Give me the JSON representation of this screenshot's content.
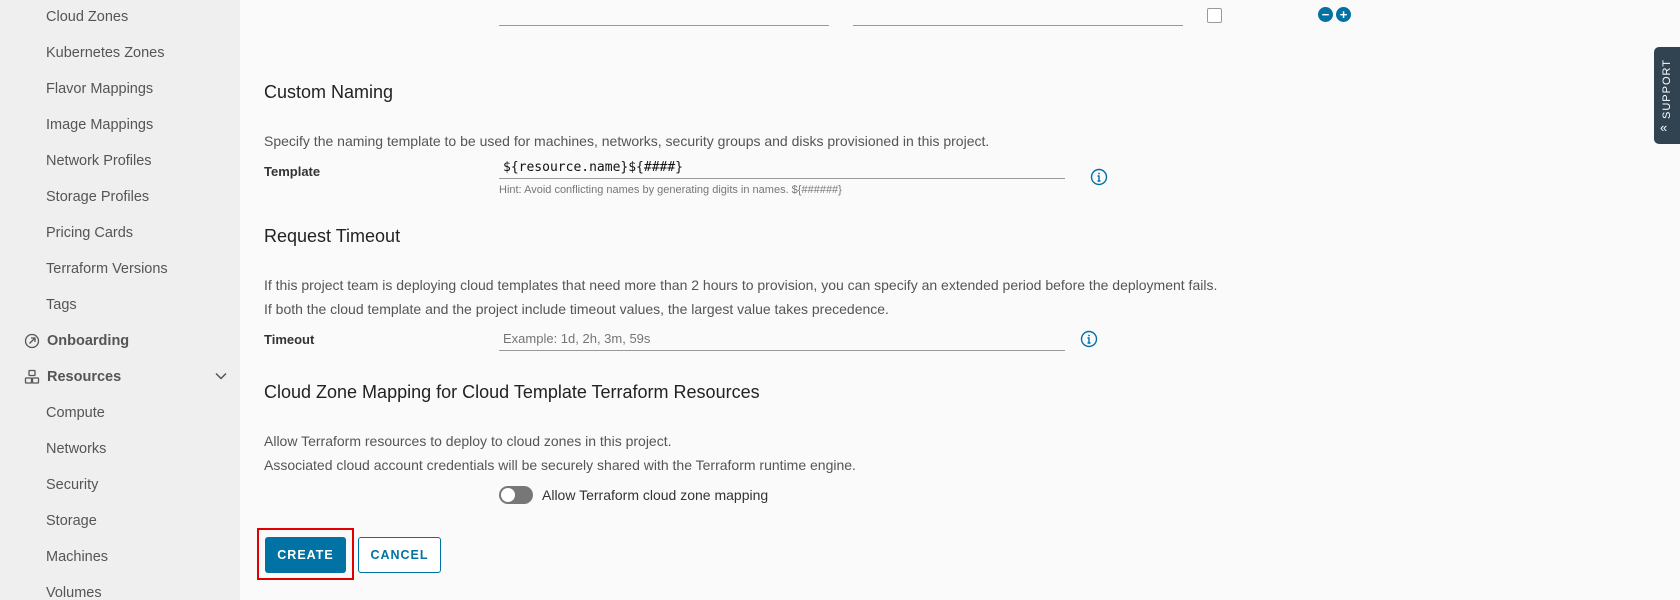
{
  "sidebar": {
    "items": [
      {
        "label": "Cloud Zones"
      },
      {
        "label": "Kubernetes Zones"
      },
      {
        "label": "Flavor Mappings"
      },
      {
        "label": "Image Mappings"
      },
      {
        "label": "Network Profiles"
      },
      {
        "label": "Storage Profiles"
      },
      {
        "label": "Pricing Cards"
      },
      {
        "label": "Terraform Versions"
      },
      {
        "label": "Tags"
      }
    ],
    "onboarding": {
      "label": "Onboarding",
      "icon": "onboarding-icon"
    },
    "resources": {
      "label": "Resources",
      "icon": "resources-icon",
      "expanded": true,
      "items": [
        {
          "label": "Compute"
        },
        {
          "label": "Networks"
        },
        {
          "label": "Security"
        },
        {
          "label": "Storage"
        },
        {
          "label": "Machines"
        },
        {
          "label": "Volumes"
        }
      ]
    }
  },
  "top_row": {
    "input1_value": "",
    "input2_value": "",
    "checkbox_checked": false,
    "remove_symbol": "−",
    "add_symbol": "+"
  },
  "custom_naming": {
    "title": "Custom Naming",
    "description": "Specify the naming template to be used for machines, networks, security groups and disks provisioned in this project.",
    "template_label": "Template",
    "template_value": "${resource.name}${####}",
    "hint": "Hint: Avoid conflicting names by generating digits in names. ${######}"
  },
  "request_timeout": {
    "title": "Request Timeout",
    "description_line1": "If this project team is deploying cloud templates that need more than 2 hours to provision, you can specify an extended period before the deployment fails.",
    "description_line2": "If both the cloud template and the project include timeout values, the largest value takes precedence.",
    "timeout_label": "Timeout",
    "timeout_placeholder": "Example: 1d, 2h, 3m, 59s",
    "timeout_value": ""
  },
  "terraform_mapping": {
    "title": "Cloud Zone Mapping for Cloud Template Terraform Resources",
    "description_line1": "Allow Terraform resources to deploy to cloud zones in this project.",
    "description_line2": "Associated cloud account credentials will be securely shared with the Terraform runtime engine.",
    "toggle_label": "Allow Terraform cloud zone mapping",
    "toggle_on": false
  },
  "actions": {
    "create_label": "CREATE",
    "cancel_label": "CANCEL"
  },
  "support": {
    "label": "SUPPORT",
    "chevron": "«"
  },
  "colors": {
    "primary": "#0072a3",
    "highlight": "#e00000",
    "sidebar_bg": "#efefef",
    "support_bg": "#314351"
  }
}
